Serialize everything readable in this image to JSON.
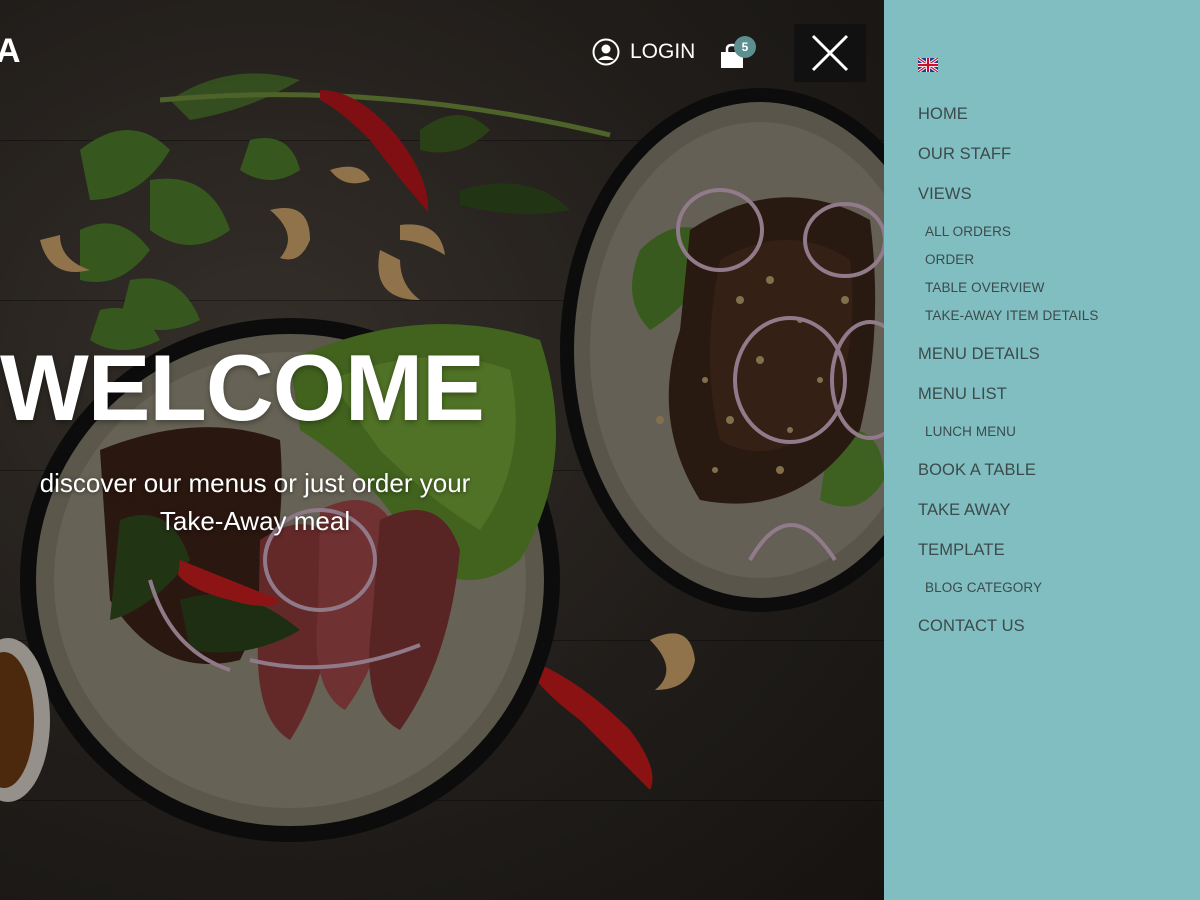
{
  "header": {
    "brand_fragment": "A",
    "login_label": "LOGIN",
    "cart_count": "5"
  },
  "hero": {
    "title": "WELCOME",
    "subtitle_line1": "discover our menus or just order your",
    "subtitle_line2": "Take-Away meal"
  },
  "sidenav": {
    "language_flag": "uk-flag-icon",
    "items": [
      {
        "label": "HOME",
        "level": 1
      },
      {
        "label": "OUR STAFF",
        "level": 1
      },
      {
        "label": "VIEWS",
        "level": 1
      },
      {
        "label": "ALL ORDERS",
        "level": 2
      },
      {
        "label": "ORDER",
        "level": 2
      },
      {
        "label": "TABLE OVERVIEW",
        "level": 2
      },
      {
        "label": "TAKE-AWAY ITEM DETAILS",
        "level": 2
      },
      {
        "label": "MENU DETAILS",
        "level": 1
      },
      {
        "label": "MENU LIST",
        "level": 1
      },
      {
        "label": "LUNCH MENU",
        "level": 2
      },
      {
        "label": "BOOK A TABLE",
        "level": 1
      },
      {
        "label": "TAKE AWAY",
        "level": 1
      },
      {
        "label": "TEMPLATE",
        "level": 1
      },
      {
        "label": "BLOG CATEGORY",
        "level": 2
      },
      {
        "label": "CONTACT US",
        "level": 1
      }
    ]
  },
  "colors": {
    "sidenav_bg": "#80bec1",
    "menu_text": "#3c4a4b",
    "badge_bg": "#5d8f90"
  }
}
